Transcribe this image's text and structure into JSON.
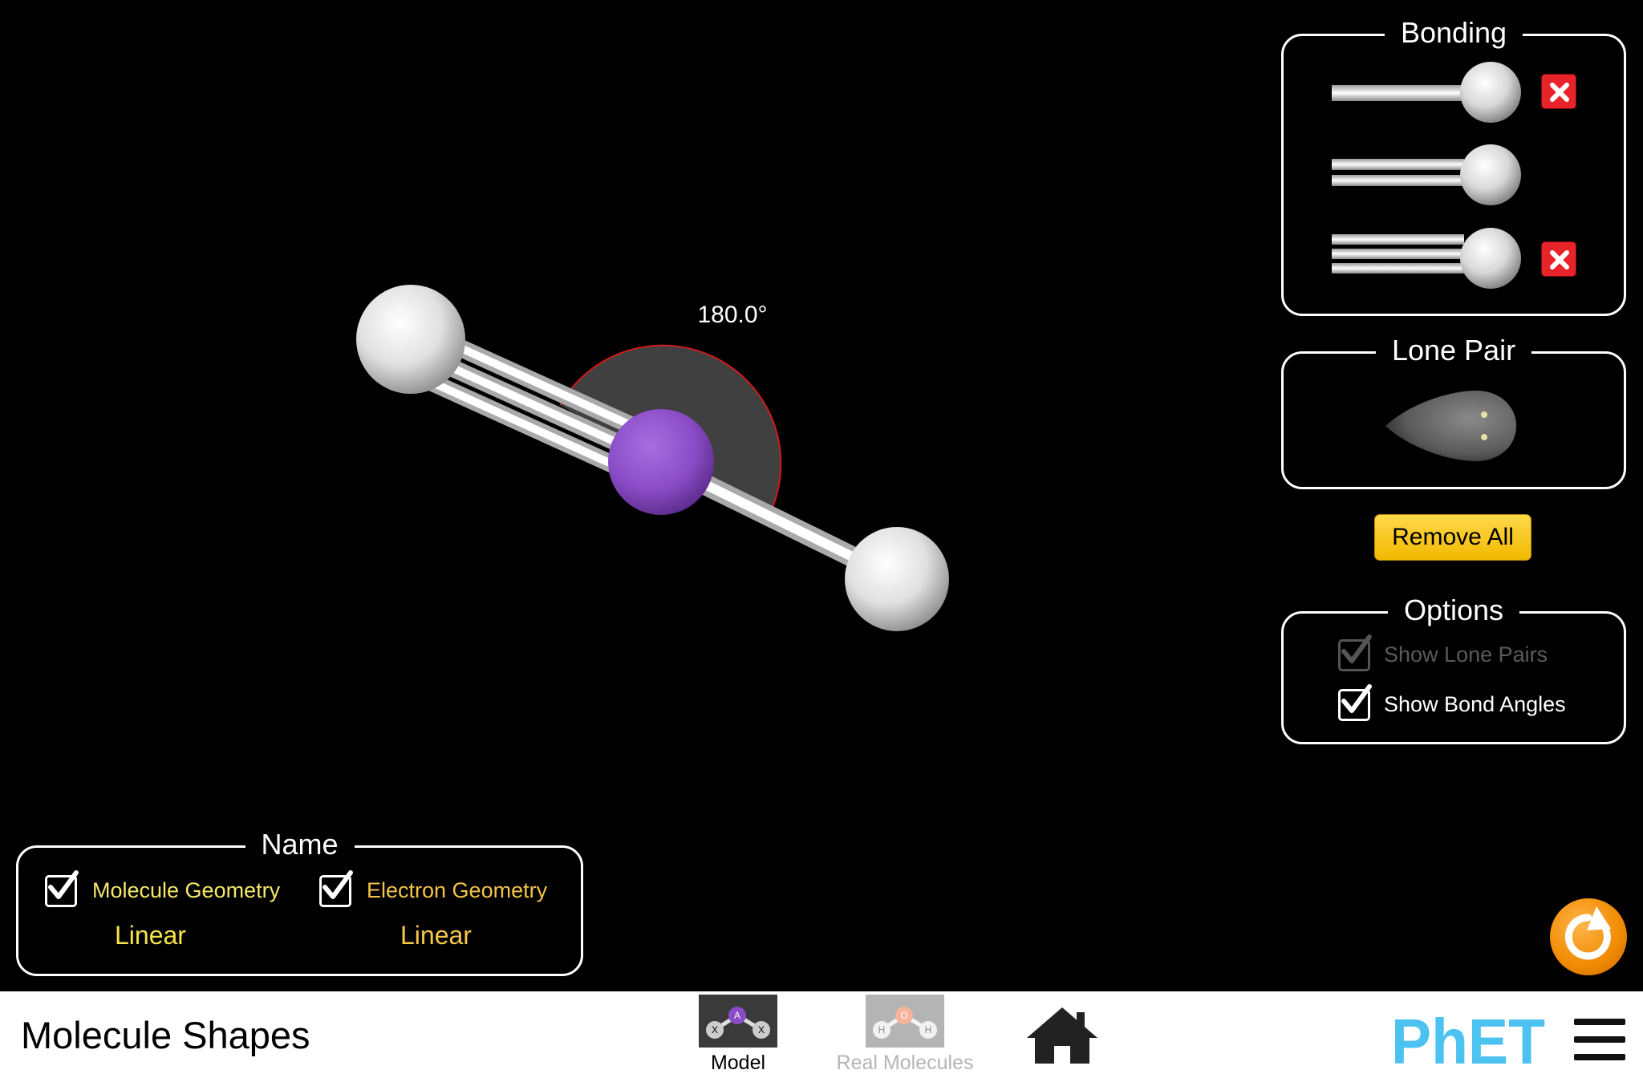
{
  "scene": {
    "bond_angle_label": "180.0°"
  },
  "bonding_panel": {
    "title": "Bonding",
    "rows": [
      {
        "bond": "single",
        "remove_icon": "remove-x-icon"
      },
      {
        "bond": "double"
      },
      {
        "bond": "triple",
        "remove_icon": "remove-x-icon"
      }
    ]
  },
  "lone_pair_panel": {
    "title": "Lone Pair"
  },
  "remove_all_label": "Remove All",
  "options_panel": {
    "title": "Options",
    "show_lone_pairs": {
      "label": "Show Lone Pairs",
      "checked": true,
      "enabled": false
    },
    "show_bond_angles": {
      "label": "Show Bond Angles",
      "checked": true,
      "enabled": true
    }
  },
  "name_panel": {
    "title": "Name",
    "molecule_geometry": {
      "label": "Molecule Geometry",
      "checked": true,
      "value": "Linear"
    },
    "electron_geometry": {
      "label": "Electron Geometry",
      "checked": true,
      "value": "Linear"
    }
  },
  "navbar": {
    "app_title": "Molecule Shapes",
    "screens": [
      {
        "label": "Model",
        "selected": true,
        "thumb_letters": [
          "A",
          "X",
          "X"
        ]
      },
      {
        "label": "Real Molecules",
        "selected": false,
        "thumb_letters": [
          "O",
          "H",
          "H"
        ]
      }
    ],
    "home_icon": "home-icon",
    "logo": "PhET",
    "menu_icon": "hamburger-menu-icon"
  },
  "colors": {
    "central_atom": "#8e52c8",
    "outer_atom": "#e8e8e8",
    "angle_arc_fill": "#404040",
    "angle_arc_stroke": "#d11a1a",
    "geometry_label": "#f4e76b",
    "geometry_value": "#f7e44a",
    "remove_all_button": "#f7c600",
    "reset_button": "#f08a00",
    "phet_blue": "#4bc2f0"
  }
}
